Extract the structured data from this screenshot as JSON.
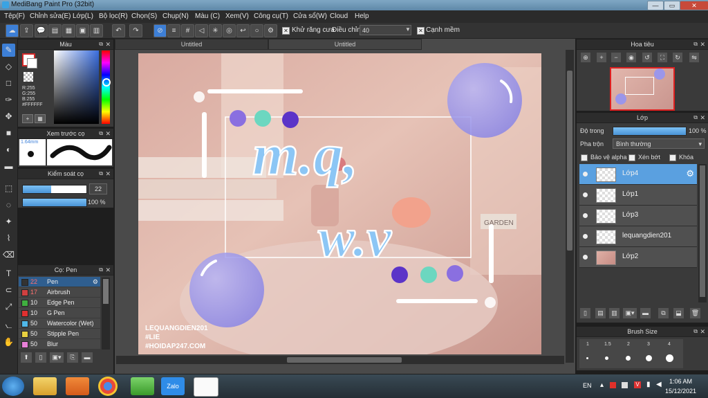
{
  "window": {
    "title": "MediBang Paint Pro (32bit)",
    "min": "—",
    "max": "▭",
    "close": "✕"
  },
  "menu": [
    "Tệp(F)",
    "Chỉnh sửa(E)",
    "Lớp(L)",
    "Bộ lọc(R)",
    "Chọn(S)",
    "Chụp(N)",
    "Màu (C)",
    "Xem(V)",
    "Công cụ(T)",
    "Cửa sổ(W)",
    "Cloud",
    "Help"
  ],
  "toolbar": {
    "antialias_label": "Khử răng cưa",
    "adjust_label": "Điều chỉnh",
    "adjust_value": "40",
    "soft_edge_label": "Cạnh mềm"
  },
  "color_panel": {
    "title": "Màu",
    "r": "R:255",
    "g": "G:255",
    "b": "B:255",
    "hex": "#FFFFFF",
    "primary_color": "#ffffff",
    "secondary_color": "#d42a2a"
  },
  "brush_preview": {
    "title": "Xem trước cọ",
    "size_text": "1.64mm"
  },
  "brush_control": {
    "title": "Kiểm soát cọ",
    "size_value": "22",
    "opacity_value": "100 %",
    "size_fraction": 0.45,
    "opacity_fraction": 1.0
  },
  "brush_panel": {
    "title": "Cọ: Pen",
    "brushes": [
      {
        "size": "22",
        "name": "Pen",
        "color": "#333333"
      },
      {
        "size": "17",
        "name": "Airbrush",
        "color": "#d04040"
      },
      {
        "size": "10",
        "name": "Edge Pen",
        "color": "#40b040"
      },
      {
        "size": "10",
        "name": "G Pen",
        "color": "#e03030"
      },
      {
        "size": "50",
        "name": "Watercolor (Wet)",
        "color": "#50b8e8"
      },
      {
        "size": "50",
        "name": "Stipple Pen",
        "color": "#e8d040"
      },
      {
        "size": "50",
        "name": "Blur",
        "color": "#e880d8"
      }
    ]
  },
  "doc_tabs": [
    "Untitled",
    "Untitled"
  ],
  "artwork": {
    "title_line1": "m.q,",
    "title_line2": "w.v",
    "watermark1": "LEQUANGDIEN201",
    "watermark2": "#LIE",
    "watermark3": "#HOIDAP247.COM",
    "sign_text": "GARDEN"
  },
  "navigator": {
    "title": "Hoa tiêu"
  },
  "layer_panel": {
    "title": "Lớp",
    "opacity_label": "Độ trong",
    "opacity_value": "100 %",
    "blend_label": "Pha trộn",
    "blend_value": "Bình thường",
    "protect_alpha": "Bảo vệ alpha",
    "clipping": "Xén bớt",
    "lock": "Khóa",
    "layers": [
      {
        "name": "Lớp4",
        "selected": true
      },
      {
        "name": "Lớp1",
        "selected": false
      },
      {
        "name": "Lớp3",
        "selected": false
      },
      {
        "name": "lequangdien201",
        "selected": false
      },
      {
        "name": "Lớp2",
        "selected": false
      }
    ]
  },
  "brush_size_panel": {
    "title": "Brush Size",
    "sizes": [
      "1",
      "1.5",
      "2",
      "3",
      "4"
    ]
  },
  "taskbar": {
    "lang": "EN",
    "time": "1:06 AM",
    "date": "15/12/2021",
    "zalo_label": "Zalo"
  }
}
